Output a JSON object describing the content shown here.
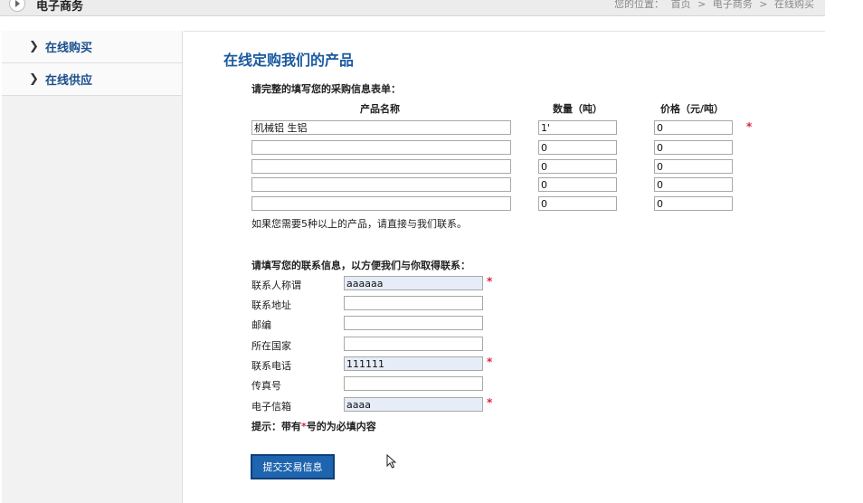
{
  "header": {
    "section_title": "电子商务",
    "breadcrumb": {
      "prefix": "您的位置：",
      "items": [
        "首页",
        "电子商务",
        "在线购买"
      ],
      "separator": ">"
    }
  },
  "sidebar": {
    "items": [
      {
        "label": "在线购买"
      },
      {
        "label": "在线供应"
      }
    ]
  },
  "main": {
    "title": "在线定购我们的产品",
    "order_intro": "请完整的填写您的采购信息表单：",
    "columns": {
      "name": "产品名称",
      "qty": "数量（吨）",
      "price": "价格（元/吨）"
    },
    "rows": [
      {
        "name": "机械铝 生铝",
        "qty": "1'",
        "price": "0"
      },
      {
        "name": "",
        "qty": "0",
        "price": "0"
      },
      {
        "name": "",
        "qty": "0",
        "price": "0"
      },
      {
        "name": "",
        "qty": "0",
        "price": "0"
      },
      {
        "name": "",
        "qty": "0",
        "price": "0"
      }
    ],
    "more_note": "如果您需要5种以上的产品，请直接与我们联系。",
    "contact_intro": "请填写您的联系信息，以方便我们与你取得联系：",
    "contact": [
      {
        "label": "联系人称谓",
        "value": "aaaaaa"
      },
      {
        "label": "联系地址",
        "value": ""
      },
      {
        "label": "邮编",
        "value": ""
      },
      {
        "label": "所在国家",
        "value": ""
      },
      {
        "label": "联系电话",
        "value": "111111"
      },
      {
        "label": "传真号",
        "value": ""
      },
      {
        "label": "电子信箱",
        "value": "aaaa"
      }
    ],
    "required_mark": "*",
    "hint": {
      "before": "提示：带有",
      "star": "*",
      "after": "号的为必填内容"
    },
    "submit_label": "提交交易信息"
  },
  "colors": {
    "accent": "#1a5aa0",
    "button": "#1e64ae",
    "required": "#d6283e",
    "filled_input": "#e6edf9"
  },
  "icons": [
    "play-circle-icon",
    "chevron-right-icon",
    "mouse-pointer-icon"
  ]
}
